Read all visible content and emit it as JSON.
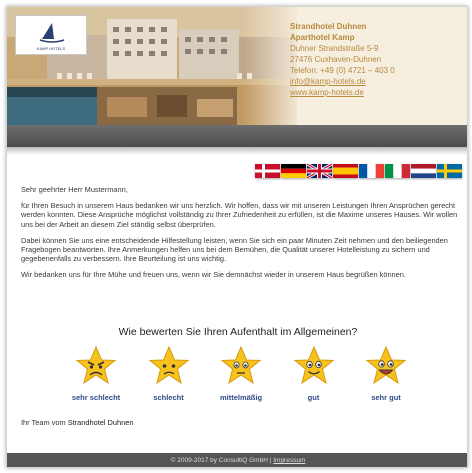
{
  "header": {
    "logo_text": "KAMP HOTELS",
    "contact": {
      "name1": "Strandhotel Duhnen",
      "name2": "Aparthotel Kamp",
      "street": "Duhner Strandstraße 5-9",
      "city": "27476 Cuxhaven-Duhnen",
      "phone": "Telefon: +49 (0) 4721 – 403 0",
      "email": "info@kamp-hotels.de",
      "web": "www.kamp-hotels.de"
    }
  },
  "flags": [
    {
      "icon": "flag-denmark"
    },
    {
      "icon": "flag-germany"
    },
    {
      "icon": "flag-uk"
    },
    {
      "icon": "flag-spain"
    },
    {
      "icon": "flag-france"
    },
    {
      "icon": "flag-italy"
    },
    {
      "icon": "flag-netherlands"
    },
    {
      "icon": "flag-sweden"
    }
  ],
  "content": {
    "salutation": "Sehr geehrter Herr Mustermann,",
    "p1": "für Ihren Besuch in unserem Haus bedanken wir uns herzlich. Wir hoffen, dass wir mit unseren Leistungen Ihren Ansprüchen gerecht werden konnten. Diese Ansprüche möglichst vollständig zu Ihrer Zufriedenheit zu erfüllen, ist die Maxime unseres Hauses. Wir wollen uns bei der Arbeit an diesem Ziel ständig selbst überprüfen.",
    "p2": "Dabei können Sie uns eine entscheidende Hilfestellung leisten, wenn Sie sich ein paar Minuten Zeit nehmen und den beiliegenden Fragebogen beantworten. Ihre Anmerkungen helfen uns bei dem Bemühen, die Qualität unserer Hotelleistung zu sichern und gegebenenfalls zu verbessern. Ihre Beurteilung ist uns wichtig.",
    "p3": "Wir bedanken uns für Ihre Mühe und freuen uns, wenn wir Sie demnächst wieder in unserem Haus begrüßen können.",
    "question": "Wie bewerten Sie Ihren Aufenthalt im Allgemeinen?"
  },
  "ratings": [
    {
      "label": "sehr schlecht",
      "icon": "star-very-angry-icon"
    },
    {
      "label": "schlecht",
      "icon": "star-sad-icon"
    },
    {
      "label": "mittelmäßig",
      "icon": "star-neutral-icon"
    },
    {
      "label": "gut",
      "icon": "star-happy-icon"
    },
    {
      "label": "sehr gut",
      "icon": "star-very-happy-icon"
    }
  ],
  "signoff": {
    "prefix": "Ihr Team vom",
    "hotel": "Strandhotel Duhnen"
  },
  "footer": {
    "copyright": "© 2009-2017 by ConsultiQ GmbH |",
    "imprint": "Impressum"
  },
  "colors": {
    "contact_text": "#b78a3c",
    "rating_label": "#2f4a8a",
    "star_fill": "#f7c21d",
    "footer_bg": "#555555"
  }
}
